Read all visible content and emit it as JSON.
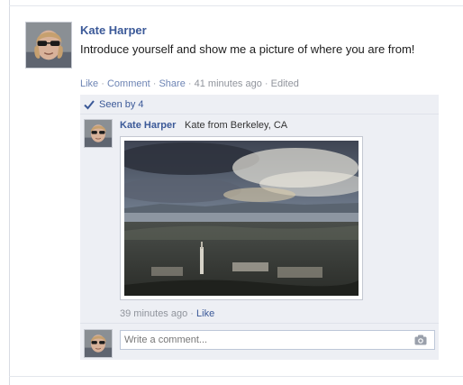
{
  "post": {
    "author": "Kate Harper",
    "text": "Introduce yourself and show me a picture of where you are from!",
    "actions": {
      "like": "Like",
      "comment": "Comment",
      "share": "Share",
      "timestamp": "41 minutes ago",
      "edited": "Edited",
      "separator": "·"
    }
  },
  "feedback": {
    "seen_by": "Seen by 4",
    "comments": [
      {
        "author": "Kate Harper",
        "text": "Kate from Berkeley, CA",
        "timestamp": "39 minutes ago",
        "like": "Like",
        "separator": "·"
      }
    ],
    "composer": {
      "placeholder": "Write a comment..."
    }
  },
  "icons": [
    "seen-check-icon",
    "camera-icon",
    "avatar",
    "berkeley-photo"
  ],
  "colors": {
    "link": "#3b5998",
    "meta": "#90949c",
    "feedback_bg": "#edeff4"
  }
}
